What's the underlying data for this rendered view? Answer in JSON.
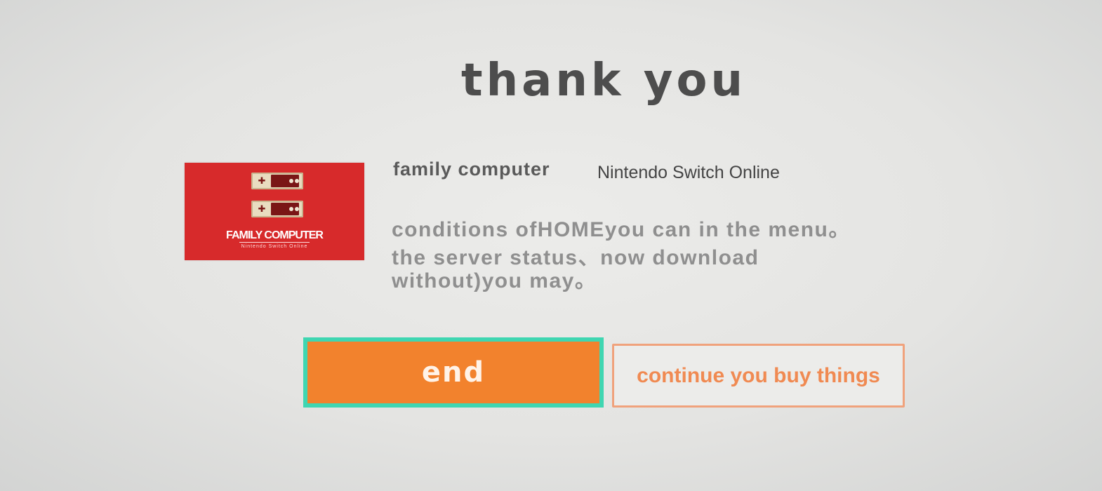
{
  "header": {
    "title": "thank you"
  },
  "product": {
    "thumbnail": {
      "logo_text": "FAMILY COMPUTER",
      "sub_text": "Nintendo Switch Online",
      "color": "#d72a2b"
    },
    "name": "family computer",
    "subtitle": "Nintendo Switch Online"
  },
  "message": {
    "line1": "conditions ofHOMEyou can in the menu。",
    "line2": "the server status、now download",
    "line3": "without)you may。"
  },
  "actions": {
    "end_label": "end",
    "continue_label": "continue you buy things",
    "accent_color": "#f2822d",
    "focus_color": "#3fd6b1"
  }
}
